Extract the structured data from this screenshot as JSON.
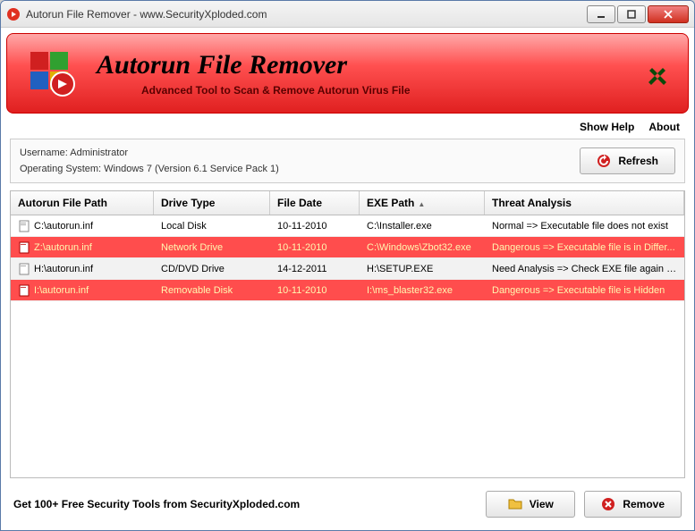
{
  "window": {
    "title": "Autorun File Remover - www.SecurityXploded.com"
  },
  "banner": {
    "title": "Autorun File Remover",
    "subtitle": "Advanced Tool to Scan & Remove Autorun Virus File"
  },
  "menu": {
    "help": "Show Help",
    "about": "About"
  },
  "info": {
    "username_label": "Username:",
    "username_value": "Administrator",
    "os_label": "Operating System:",
    "os_value": "Windows 7 (Version 6.1 Service Pack 1)",
    "refresh": "Refresh"
  },
  "grid": {
    "headers": {
      "path": "Autorun File Path",
      "drive": "Drive Type",
      "date": "File Date",
      "exe": "EXE Path",
      "threat": "Threat Analysis"
    },
    "rows": [
      {
        "path": "C:\\autorun.inf",
        "drive": "Local Disk",
        "date": "10-11-2010",
        "exe": "C:\\Installer.exe",
        "threat": "Normal => Executable file does not exist",
        "danger": false
      },
      {
        "path": "Z:\\autorun.inf",
        "drive": "Network Drive",
        "date": "10-11-2010",
        "exe": "C:\\Windows\\Zbot32.exe",
        "threat": "Dangerous => Executable file is in Differ...",
        "danger": true
      },
      {
        "path": "H:\\autorun.inf",
        "drive": "CD/DVD Drive",
        "date": "14-12-2011",
        "exe": "H:\\SETUP.EXE",
        "threat": "Need Analysis => Check EXE file again b...",
        "danger": false
      },
      {
        "path": "I:\\autorun.inf",
        "drive": "Removable Disk",
        "date": "10-11-2010",
        "exe": "I:\\ms_blaster32.exe",
        "threat": "Dangerous => Executable file is Hidden",
        "danger": true
      }
    ]
  },
  "footer": {
    "promo": "Get 100+ Free Security Tools from SecurityXploded.com",
    "view": "View",
    "remove": "Remove"
  }
}
